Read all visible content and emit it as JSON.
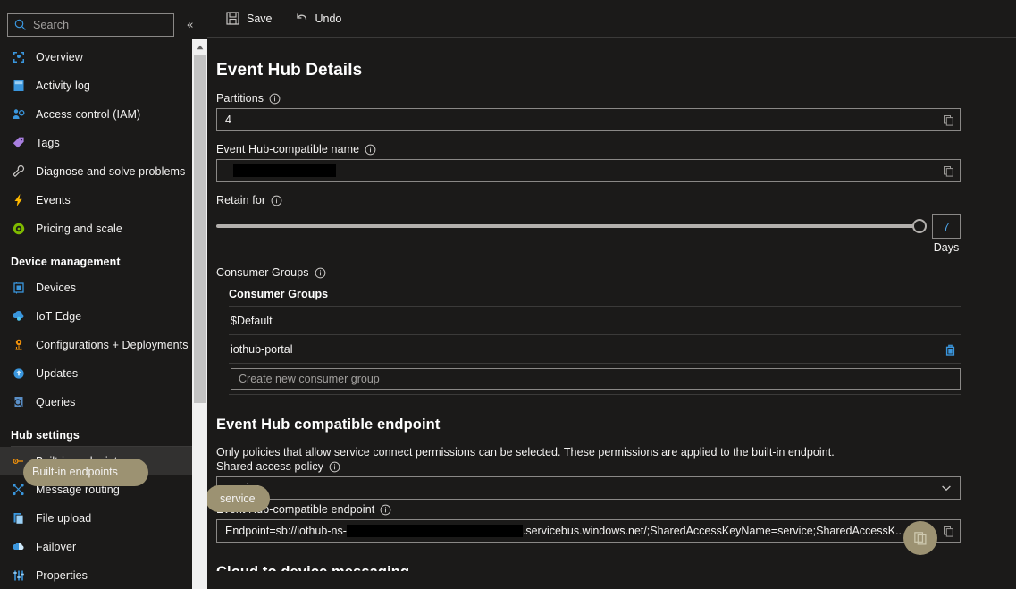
{
  "sidebar": {
    "search": {
      "placeholder": "Search",
      "icon": "search-icon"
    },
    "collapse_label": "«",
    "items": [
      {
        "label": "Overview",
        "icon": "overview-icon"
      },
      {
        "label": "Activity log",
        "icon": "activity-log-icon"
      },
      {
        "label": "Access control (IAM)",
        "icon": "access-control-icon"
      },
      {
        "label": "Tags",
        "icon": "tags-icon"
      },
      {
        "label": "Diagnose and solve problems",
        "icon": "diagnose-icon"
      },
      {
        "label": "Events",
        "icon": "events-icon"
      },
      {
        "label": "Pricing and scale",
        "icon": "pricing-icon"
      }
    ],
    "group_device_management": "Device management",
    "device_items": [
      {
        "label": "Devices",
        "icon": "devices-icon"
      },
      {
        "label": "IoT Edge",
        "icon": "iot-edge-icon"
      },
      {
        "label": "Configurations + Deployments",
        "icon": "configurations-icon"
      },
      {
        "label": "Updates",
        "icon": "updates-icon"
      },
      {
        "label": "Queries",
        "icon": "queries-icon"
      }
    ],
    "group_hub_settings": "Hub settings",
    "hub_items": [
      {
        "label": "Built-in endpoints",
        "icon": "endpoint-icon",
        "selected": true
      },
      {
        "label": "Message routing",
        "icon": "message-routing-icon"
      },
      {
        "label": "File upload",
        "icon": "file-upload-icon"
      },
      {
        "label": "Failover",
        "icon": "failover-icon"
      },
      {
        "label": "Properties",
        "icon": "properties-icon"
      }
    ]
  },
  "toolbar": {
    "save_label": "Save",
    "undo_label": "Undo"
  },
  "main": {
    "section_title": "Event Hub Details",
    "partitions": {
      "label": "Partitions",
      "value": "4"
    },
    "eh_name": {
      "label": "Event Hub-compatible name",
      "value": ""
    },
    "retain": {
      "label": "Retain for",
      "value": "7",
      "unit": "Days"
    },
    "consumer_groups": {
      "label": "Consumer Groups",
      "column_header": "Consumer Groups",
      "rows": [
        {
          "name": "$Default",
          "deletable": false
        },
        {
          "name": "iothub-portal",
          "deletable": true
        }
      ],
      "new_placeholder": "Create new consumer group"
    },
    "endpoint_section": {
      "title": "Event Hub compatible endpoint",
      "description": "Only policies that allow service connect permissions can be selected. These permissions are applied to the built-in endpoint.",
      "policy_label": "Shared access policy",
      "policy_value": "service",
      "endpoint_label": "Event Hub-compatible endpoint",
      "endpoint_prefix": "Endpoint=sb://iothub-ns-",
      "endpoint_suffix": ".servicebus.windows.net/;SharedAccessKeyName=service;SharedAccessK..."
    },
    "next_section_title": "Cloud to device messaging"
  },
  "colors": {
    "background": "#1b1a19",
    "accent_blue": "#4ea6ea",
    "highlight_tan": "#9c9272",
    "border": "#8a8886",
    "selected_row": "#323130"
  }
}
